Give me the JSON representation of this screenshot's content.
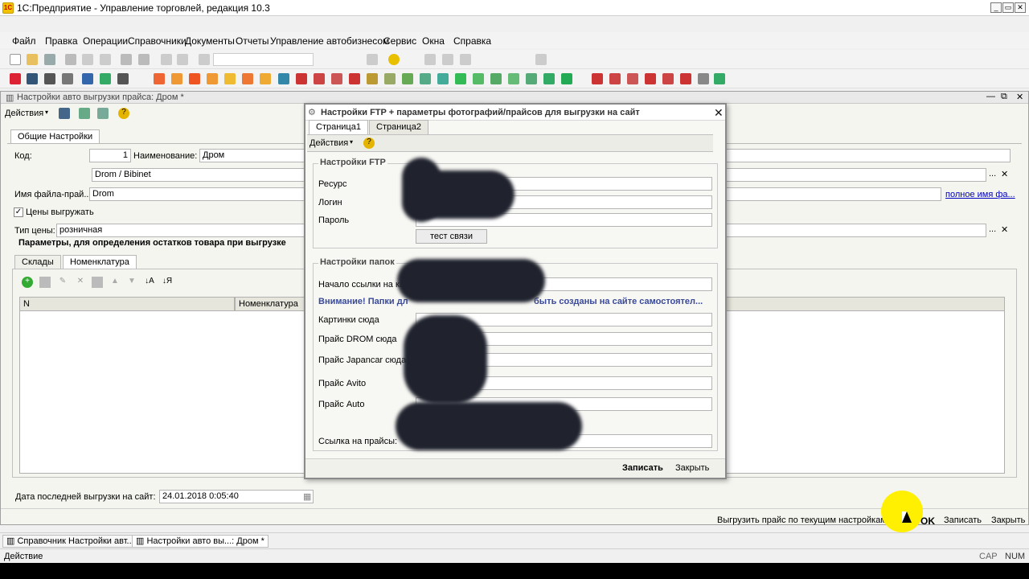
{
  "app": {
    "title": "1С:Предприятие - Управление торговлей, редакция 10.3"
  },
  "menu": [
    "Файл",
    "Правка",
    "Операции",
    "Справочники",
    "Документы",
    "Отчеты",
    "Управление автобизнесом",
    "Сервис",
    "Окна",
    "Справка"
  ],
  "doc": {
    "title": "Настройки авто выгрузки прайса: Дром *",
    "actions_label": "Действия",
    "tab_general": "Общие Настройки",
    "code_label": "Код:",
    "code_value": "1",
    "name_label": "Наименование:",
    "name_value": "Дром",
    "source_value": "Drom / Bibinet",
    "filename_label": "Имя файла-прай...",
    "filename_value": "Drom",
    "full_name_link": "полное имя фа...",
    "prices_checkbox": "Цены выгружать",
    "price_type_label": "Тип цены:",
    "price_type_value": "розничная",
    "params_heading": "Параметры, для определения остатков товара при выгрузке",
    "tabs": [
      "Склады",
      "Номенклатура"
    ],
    "grid_cols": [
      "N",
      "Номенклатура"
    ],
    "last_upload_label": "Дата последней выгрузки на сайт:",
    "last_upload_value": "24.01.2018  0:05:40",
    "bottom_upload": "Выгрузить прайс по текущим настройкам",
    "bottom_ok": "OK",
    "bottom_save": "Записать",
    "bottom_close": "Закрыть"
  },
  "modal": {
    "title": "Настройки FTP + параметры фотографий/прайсов для выгрузки на сайт",
    "tabs": [
      "Страница1",
      "Страница2"
    ],
    "actions_label": "Действия",
    "ftp_group": "Настройки FTP",
    "ftp_fields": [
      "Ресурс",
      "Логин",
      "Пароль"
    ],
    "test_button": "тест связи",
    "folders_group": "Настройки папок",
    "folder_start": "Начало ссылки на ка",
    "warning": "Внимание! Папки дл",
    "warning_tail": "быть созданы на сайте самостоятел...",
    "folder_fields": [
      "Картинки сюда",
      "Прайс  DROM сюда",
      "Прайс  Japancar сюда",
      "Прайс  Avito",
      "Прайс  Auto"
    ],
    "link_label": "Ссылка на прайсы:",
    "save_btn": "Записать",
    "close_btn": "Закрыть"
  },
  "taskbar": [
    "Справочник Настройки авт...",
    "Настройки авто вы...: Дром *"
  ],
  "status": {
    "left": "Действие",
    "caps": "CAP",
    "num": "NUM"
  },
  "colors": {
    "accent_link": "#0000c0",
    "warning_text": "#3a4a9a",
    "blur_dark": "#20232e",
    "cursor_highlight": "#ffef00"
  }
}
